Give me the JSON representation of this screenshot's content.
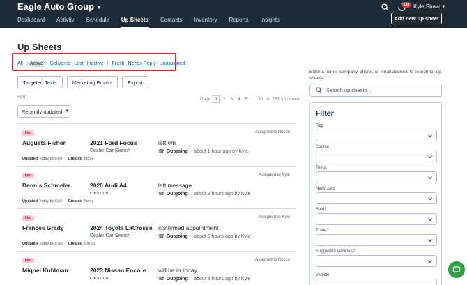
{
  "header": {
    "brand": "Eagle Auto Group",
    "tabs": [
      "Dashboard",
      "Activity",
      "Schedule",
      "Up Sheets",
      "Contacts",
      "Inventory",
      "Reports",
      "Insights"
    ],
    "active_tab": "Up Sheets",
    "notification_count": "140",
    "user_name": "Kyle Shaw",
    "add_button": "Add new up sheet"
  },
  "page": {
    "title": "Up Sheets",
    "filters": [
      "All",
      "Active",
      "Delivered",
      "Lost",
      "Inactive",
      "Fresh",
      "Needs Reply",
      "Unassigned"
    ],
    "active_filter": "Active",
    "actions": [
      "Targeted Texts",
      "Marketing Emails",
      "Export"
    ],
    "sort_label": "Sort",
    "sort_value": "Recently updated",
    "pager": {
      "label": "Page",
      "pages": [
        "1",
        "2",
        "3",
        "4",
        "5"
      ],
      "current": "1",
      "ellipsis": "...",
      "last": "21",
      "summary": "of 252 up sheets"
    }
  },
  "items": [
    {
      "tag": "Hot",
      "assigned": "Assigned to Rocco",
      "name": "Augusta Fisher",
      "vehicle": "2021 Ford Focus",
      "source": "Dealer Car Search",
      "note": "left vm",
      "direction": "Outgoing",
      "when": "about 1 hour ago by Kyle",
      "updated_label": "Updated",
      "updated": "Today by Kyle",
      "created_label": "Created",
      "created": "Today"
    },
    {
      "tag": "Hot",
      "assigned": "Assigned to Kyle",
      "name": "Dennis Schmeler",
      "vehicle": "2020 Audi A4",
      "source": "cars.com",
      "note": "left message",
      "direction": "Outgoing",
      "when": "about 3 hours ago by Kyle",
      "updated_label": "Updated",
      "updated": "Today by Kyle",
      "created_label": "Created",
      "created": "Today"
    },
    {
      "tag": "Hot",
      "assigned": "Assigned to Kyle",
      "name": "Frances Grady",
      "vehicle": "2024 Toyota LaCrosse",
      "source": "Dealer Car Search",
      "note": "confirmed appointment",
      "direction": "Outgoing",
      "when": "about 5 hours ago by Kyle",
      "updated_label": "Updated",
      "updated": "Today by Kyle",
      "created_label": "Created",
      "created": "Aug 21"
    },
    {
      "tag": "Hot",
      "assigned": "Assigned to Rocco",
      "name": "Miquel Kuhlman",
      "vehicle": "2023 Nissan Encore",
      "source": "cars.com",
      "note": "will be in today",
      "direction": "Outgoing",
      "when": "about 5 hours ago by Kyle",
      "updated_label": "Updated",
      "updated": "Today by Kyle",
      "created_label": "Created",
      "created": "Today"
    }
  ],
  "sidebar": {
    "search_help": "Enter a name, company, phone, or email address to search for up sheets:",
    "search_placeholder": "Search up sheets...",
    "filter_title": "Filter",
    "filter_fields": [
      "Rep",
      "Source",
      "Temp.",
      "New/Used",
      "Sold?",
      "Trade?",
      "Suggested Vehicles?",
      "Vehicle"
    ]
  },
  "colors": {
    "header_bg": "#1d2b36",
    "highlight_border": "#e3262b",
    "hot_tag": "#f8c8d3",
    "chat_button": "#2ea043"
  }
}
